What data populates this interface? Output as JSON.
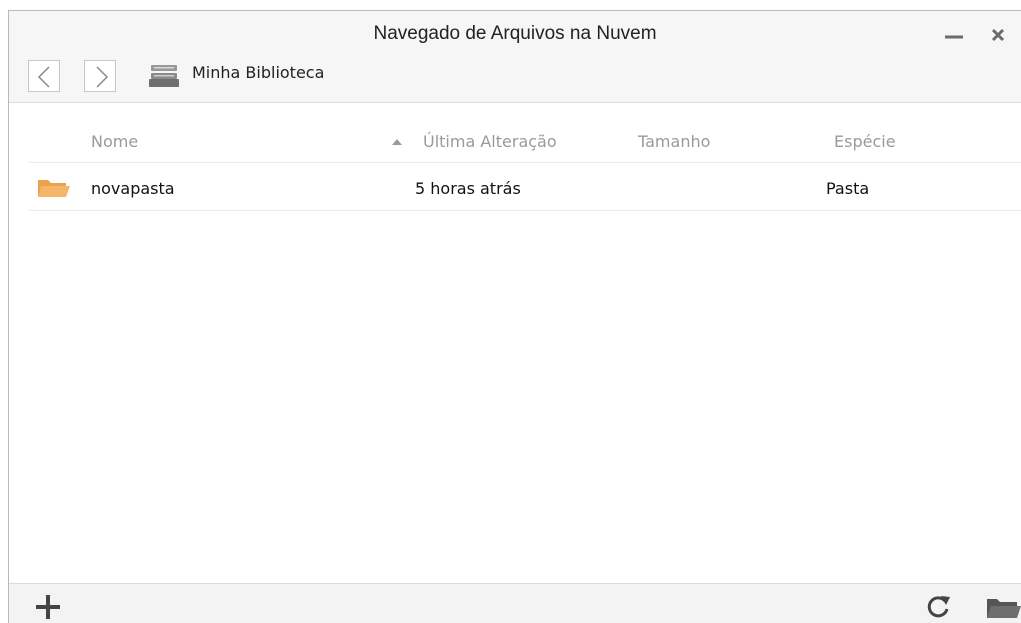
{
  "window": {
    "title": "Navegado de Arquivos na Nuvem"
  },
  "toolbar": {
    "back_icon": "chevron-left-icon",
    "forward_icon": "chevron-right-icon",
    "location_icon": "drive-icon",
    "location_label": "Minha Biblioteca"
  },
  "table": {
    "columns": [
      "Nome",
      "Última Alteração",
      "Tamanho",
      "Espécie"
    ],
    "sorted_column": "Última Alteração",
    "sort_direction": "ascending",
    "rows": [
      {
        "icon": "folder-icon",
        "name": "novapasta",
        "modified": "5 horas atrás",
        "size": "",
        "kind": "Pasta"
      }
    ]
  },
  "footer": {
    "add_icon": "plus-icon",
    "refresh_icon": "refresh-icon",
    "open_icon": "folder-open-icon"
  },
  "colors": {
    "folder": "#f5b667",
    "header_text": "#9a9a9a",
    "toolbar_bg": "#f6f6f6"
  }
}
